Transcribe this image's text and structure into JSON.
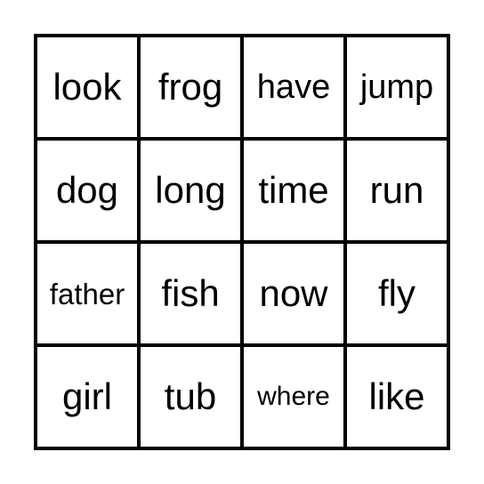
{
  "board": {
    "rows": 4,
    "cols": 4,
    "cells": [
      [
        "look",
        "frog",
        "have",
        "jump"
      ],
      [
        "dog",
        "long",
        "time",
        "run"
      ],
      [
        "father",
        "fish",
        "now",
        "fly"
      ],
      [
        "girl",
        "tub",
        "where",
        "like"
      ]
    ]
  }
}
